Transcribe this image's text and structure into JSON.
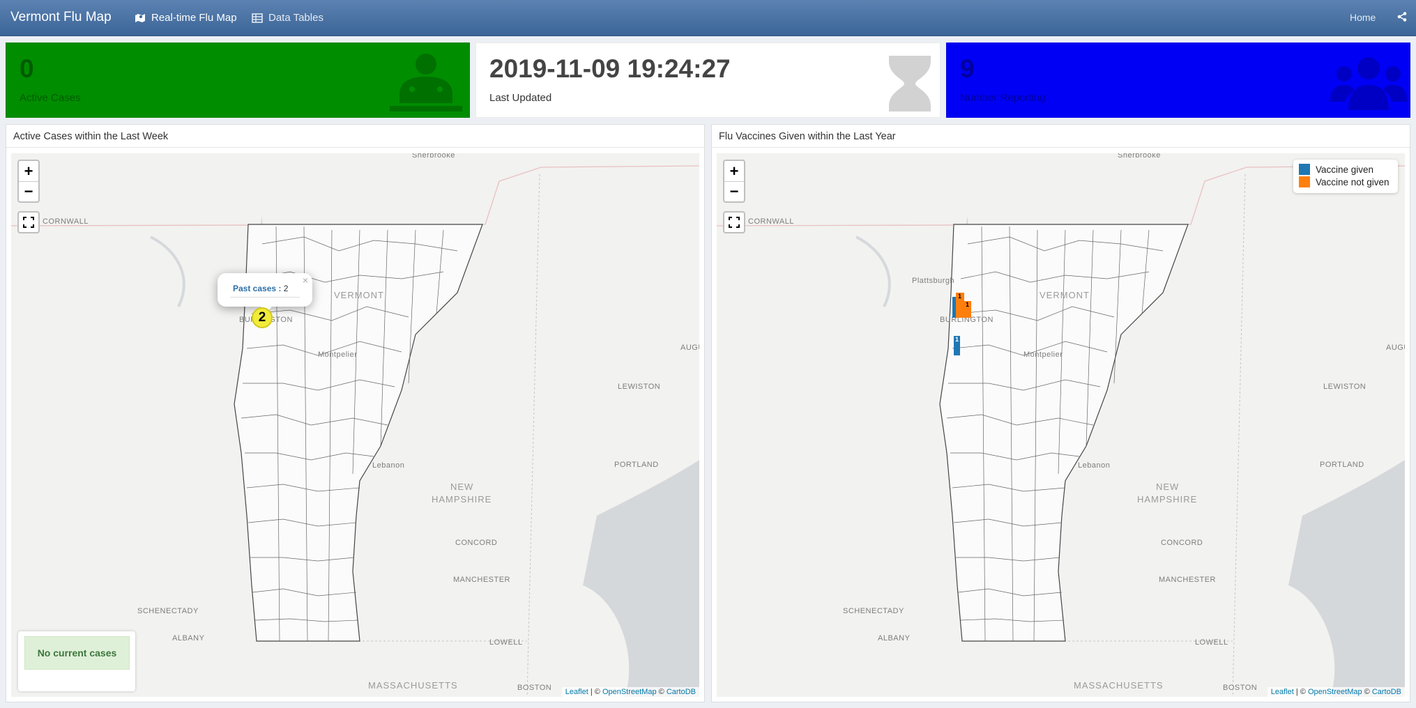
{
  "navbar": {
    "brand": "Vermont Flu Map",
    "tabs": [
      {
        "label": "Real-time Flu Map",
        "icon": "map-icon",
        "active": true
      },
      {
        "label": "Data Tables",
        "icon": "table-icon",
        "active": false
      }
    ],
    "home_label": "Home",
    "share_icon": "share-icon"
  },
  "value_boxes": [
    {
      "value": "0",
      "label": "Active Cases",
      "color": "#008d00",
      "icon": "user-doctor-icon"
    },
    {
      "value": "2019-11-09 19:24:27",
      "label": "Last Updated",
      "color": "#ffffff",
      "icon": "hourglass-icon"
    },
    {
      "value": "9",
      "label": "Number Reporting",
      "color": "#0000f5",
      "icon": "users-icon"
    }
  ],
  "panels": {
    "left": {
      "title": "Active Cases within the Last Week",
      "popup": {
        "key": "Past cases :",
        "value": "2"
      },
      "marker_count": "2",
      "status_message": "No current cases"
    },
    "right": {
      "title": "Flu Vaccines Given within the Last Year",
      "legend": [
        {
          "label": "Vaccine given",
          "color": "#1f77b4"
        },
        {
          "label": "Vaccine not given",
          "color": "#ff7f0e"
        }
      ],
      "bar_labels": [
        "1",
        "1",
        "1"
      ]
    }
  },
  "map_labels": {
    "cities": [
      "Sherbrooke",
      "CORNWALL",
      "Plattsburgh",
      "BURLINGTON",
      "Montpelier",
      "AUGU",
      "LEWISTON",
      "Lebanon",
      "PORTLAND",
      "CONCORD",
      "MANCHESTER",
      "SCHENECTADY",
      "ALBANY",
      "LOWELL",
      "BOSTON"
    ],
    "states": [
      "VERMONT",
      "NEW",
      "HAMPSHIRE",
      "MASSACHUSETTS"
    ]
  },
  "attribution": {
    "leaflet": "Leaflet",
    "sep": " | © ",
    "osm": "OpenStreetMap",
    "sep2": " © ",
    "carto": "CartoDB"
  }
}
